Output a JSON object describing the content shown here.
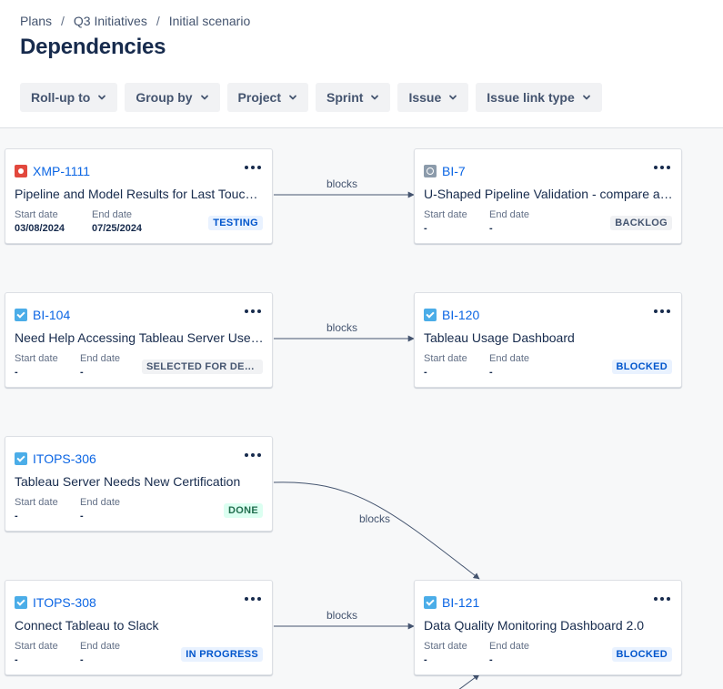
{
  "breadcrumb": [
    "Plans",
    "Q3 Initiatives",
    "Initial scenario"
  ],
  "title": "Dependencies",
  "filters": [
    "Roll-up to",
    "Group by",
    "Project",
    "Sprint",
    "Issue",
    "Issue link type"
  ],
  "labels": {
    "start": "Start date",
    "end": "End date"
  },
  "link_label": "blocks",
  "cards": [
    {
      "key": "XMP-1111",
      "type": "bug",
      "summary": "Pipeline and Model Results for Last Touch Attribution",
      "start": "03/08/2024",
      "end": "07/25/2024",
      "status": "TESTING",
      "status_color": "blue"
    },
    {
      "key": "BI-7",
      "type": "subtask",
      "summary": "U-Shaped Pipeline Validation - compare against source",
      "start": "-",
      "end": "-",
      "status": "BACKLOG",
      "status_color": "gray"
    },
    {
      "key": "BI-104",
      "type": "task",
      "summary": "Need Help Accessing Tableau Server Users List",
      "start": "-",
      "end": "-",
      "status": "SELECTED FOR DEVELOPMENT",
      "status_color": "gray"
    },
    {
      "key": "BI-120",
      "type": "task",
      "summary": "Tableau Usage Dashboard",
      "start": "-",
      "end": "-",
      "status": "BLOCKED",
      "status_color": "blue"
    },
    {
      "key": "ITOPS-306",
      "type": "task",
      "summary": "Tableau Server Needs New Certification",
      "start": "-",
      "end": "-",
      "status": "DONE",
      "status_color": "green"
    },
    {
      "key": "ITOPS-308",
      "type": "task",
      "summary": "Connect Tableau to Slack",
      "start": "-",
      "end": "-",
      "status": "IN PROGRESS",
      "status_color": "blue"
    },
    {
      "key": "BI-121",
      "type": "task",
      "summary": "Data Quality Monitoring Dashboard 2.0",
      "start": "-",
      "end": "-",
      "status": "BLOCKED",
      "status_color": "blue"
    }
  ]
}
